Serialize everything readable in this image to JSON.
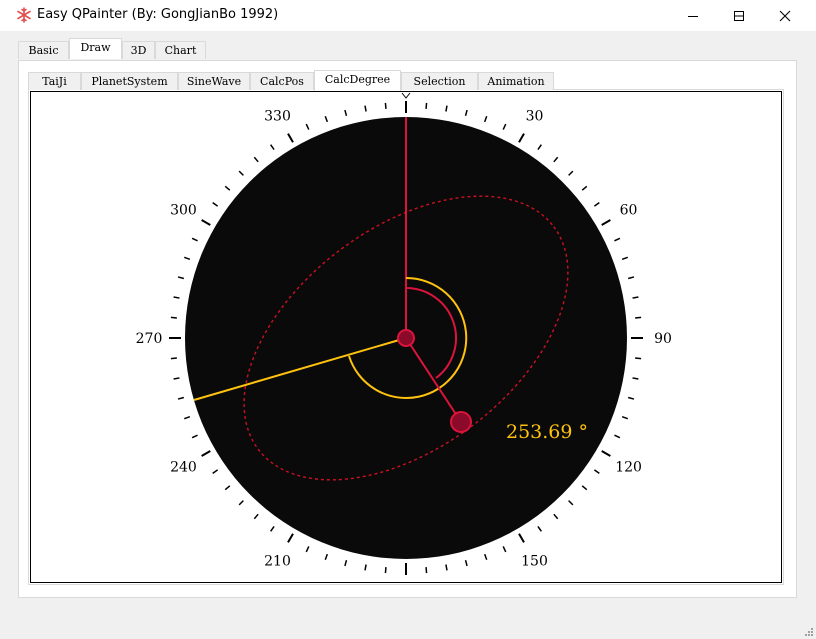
{
  "window": {
    "title": "Easy QPainter (By: GongJianBo 1992)",
    "app_icon": "snowflake-icon",
    "controls": [
      "minimize-icon",
      "maximize-icon",
      "close-icon"
    ]
  },
  "outer_tabs": [
    {
      "label": "Basic",
      "active": false
    },
    {
      "label": "Draw",
      "active": true
    },
    {
      "label": "3D",
      "active": false
    },
    {
      "label": "Chart",
      "active": false
    }
  ],
  "inner_tabs": [
    {
      "label": "TaiJi",
      "active": false
    },
    {
      "label": "PlanetSystem",
      "active": false
    },
    {
      "label": "SineWave",
      "active": false
    },
    {
      "label": "CalcPos",
      "active": false
    },
    {
      "label": "CalcDegree",
      "active": true
    },
    {
      "label": "Selection",
      "active": false
    },
    {
      "label": "Animation",
      "active": false
    }
  ],
  "dial": {
    "labels": [
      "30",
      "60",
      "90",
      "120",
      "150",
      "210",
      "240",
      "270",
      "300",
      "330"
    ],
    "degree_readout": "253.69 °",
    "angle_degrees": 253.69,
    "colors": {
      "background": "#0a0a0a",
      "accent_red": "#dc143c",
      "accent_yellow": "#ffc20e",
      "ellipse": "#cc1122",
      "ticks": "#000000"
    }
  }
}
